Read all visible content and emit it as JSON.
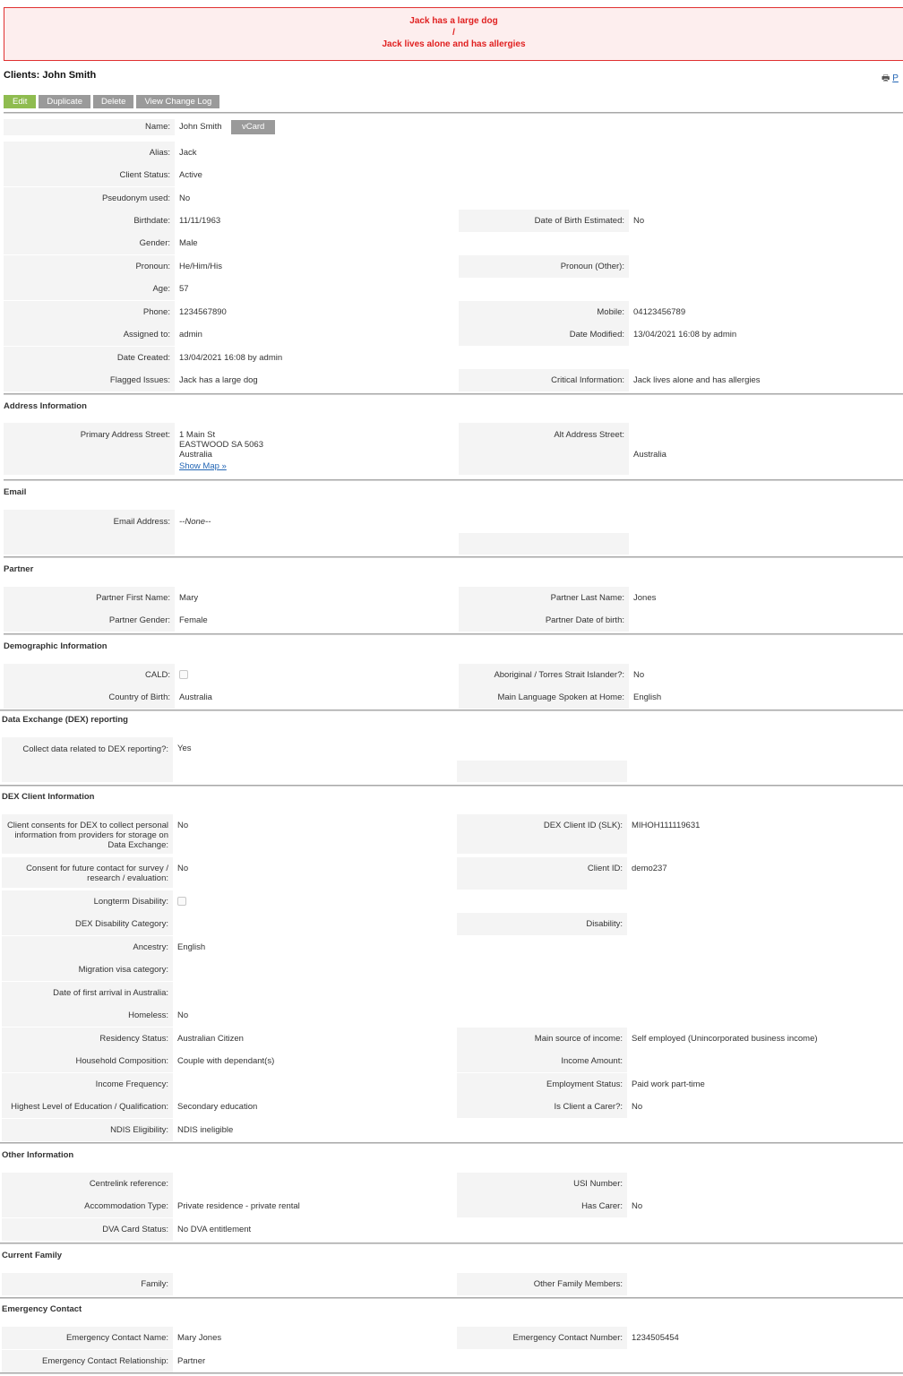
{
  "alert": {
    "line1": "Jack has a large dog",
    "sep": "/",
    "line2": "Jack lives alone and has allergies"
  },
  "header": {
    "title": "Clients: John Smith",
    "print_label": "P"
  },
  "toolbar": {
    "edit": "Edit",
    "duplicate": "Duplicate",
    "delete": "Delete",
    "change_log": "View Change Log"
  },
  "vcard_label": "vCard",
  "sections": {
    "address": "Address Information",
    "email": "Email",
    "partner": "Partner",
    "demographic": "Demographic Information",
    "dex": "Data Exchange (DEX) reporting",
    "dex_client": "DEX Client Information",
    "other": "Other Information",
    "family": "Current Family",
    "emergency": "Emergency Contact"
  },
  "overview": {
    "name_label": "Name:",
    "name": "John Smith",
    "alias_label": "Alias:",
    "alias": "Jack",
    "status_label": "Client Status:",
    "status": "Active",
    "pseudonym_label": "Pseudonym used:",
    "pseudonym": "No",
    "birthdate_label": "Birthdate:",
    "birthdate": "11/11/1963",
    "dob_est_label": "Date of Birth Estimated:",
    "dob_est": "No",
    "gender_label": "Gender:",
    "gender": "Male",
    "pronoun_label": "Pronoun:",
    "pronoun": "He/Him/His",
    "pronoun_other_label": "Pronoun (Other):",
    "age_label": "Age:",
    "age": "57",
    "phone_label": "Phone:",
    "phone": "1234567890",
    "mobile_label": "Mobile:",
    "mobile": "04123456789",
    "assigned_label": "Assigned to:",
    "assigned": "admin",
    "modified_label": "Date Modified:",
    "modified": "13/04/2021 16:08 by admin",
    "created_label": "Date Created:",
    "created": "13/04/2021 16:08 by admin",
    "flagged_label": "Flagged Issues:",
    "flagged": "Jack has a large dog",
    "critical_label": "Critical Information:",
    "critical": "Jack lives alone and has allergies"
  },
  "address": {
    "primary_label": "Primary Address Street:",
    "primary_line1": "1 Main St",
    "primary_line2": "EASTWOOD SA  5063",
    "primary_line3": "Australia",
    "show_map": "Show Map »",
    "alt_label": "Alt Address Street:",
    "alt_country": "Australia"
  },
  "email": {
    "label": "Email Address:",
    "value": "--None--"
  },
  "partner": {
    "first_label": "Partner First Name:",
    "first": "Mary",
    "last_label": "Partner Last Name:",
    "last": "Jones",
    "gender_label": "Partner Gender:",
    "gender": "Female",
    "dob_label": "Partner Date of birth:"
  },
  "demographic": {
    "cald_label": "CALD:",
    "cald_checked": false,
    "atsi_label": "Aboriginal / Torres Strait Islander?:",
    "atsi": "No",
    "cob_label": "Country of Birth:",
    "cob": "Australia",
    "lang_label": "Main Language Spoken at Home:",
    "lang": "English"
  },
  "dex": {
    "collect_label": "Collect data related to DEX reporting?:",
    "collect": "Yes"
  },
  "dex_client": {
    "consent_label": "Client consents for DEX to collect personal information from providers for storage on Data Exchange:",
    "consent": "No",
    "slk_label": "DEX Client ID (SLK):",
    "slk": "MIHOH111119631",
    "future_label": "Consent for future contact for survey / research / evaluation:",
    "future": "No",
    "client_id_label": "Client ID:",
    "client_id": "demo237",
    "longterm_label": "Longterm Disability:",
    "longterm_checked": false,
    "dis_cat_label": "DEX Disability Category:",
    "disability_label": "Disability:",
    "ancestry_label": "Ancestry:",
    "ancestry": "English",
    "visa_label": "Migration visa category:",
    "arrival_label": "Date of first arrival in Australia:",
    "homeless_label": "Homeless:",
    "homeless": "No",
    "residency_label": "Residency Status:",
    "residency": "Australian Citizen",
    "income_src_label": "Main source of income:",
    "income_src": "Self employed (Unincorporated business income)",
    "household_label": "Household Composition:",
    "household": "Couple with dependant(s)",
    "income_amt_label": "Income Amount:",
    "income_freq_label": "Income Frequency:",
    "employment_label": "Employment Status:",
    "employment": "Paid work part-time",
    "education_label": "Highest Level of Education / Qualification:",
    "education": "Secondary education",
    "carer_label": "Is Client a Carer?:",
    "carer": "No",
    "ndis_label": "NDIS Eligibility:",
    "ndis": "NDIS ineligible"
  },
  "other": {
    "centrelink_label": "Centrelink reference:",
    "usi_label": "USI Number:",
    "accom_label": "Accommodation Type:",
    "accom": "Private residence - private rental",
    "has_carer_label": "Has Carer:",
    "has_carer": "No",
    "dva_label": "DVA Card Status:",
    "dva": "No DVA entitlement"
  },
  "family": {
    "family_label": "Family:",
    "others_label": "Other Family Members:"
  },
  "emergency": {
    "name_label": "Emergency Contact Name:",
    "name": "Mary Jones",
    "number_label": "Emergency Contact Number:",
    "number": "1234505454",
    "relationship_label": "Emergency Contact Relationship:",
    "relationship": "Partner"
  }
}
